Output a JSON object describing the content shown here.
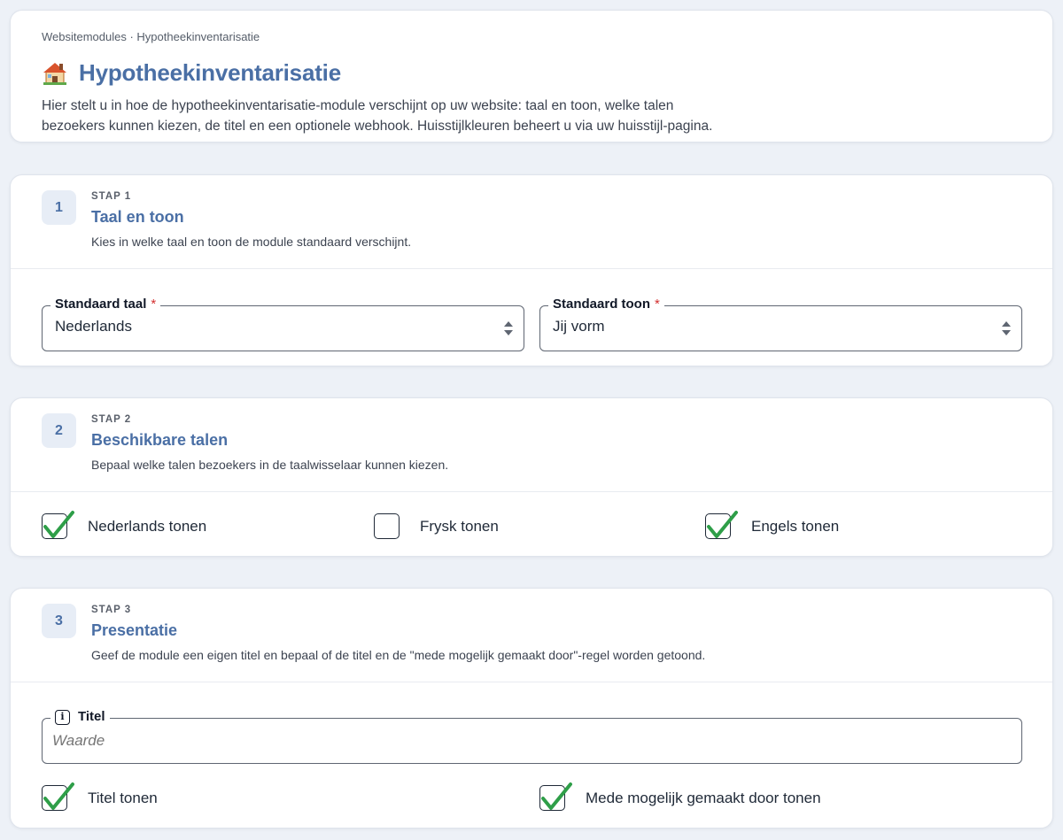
{
  "breadcrumb": "Websitemodules · Hypotheekinventarisatie",
  "page": {
    "title": "Hypotheekinventarisatie",
    "icon": "house-icon",
    "intro": "Hier stelt u in hoe de hypotheekinventarisatie-module verschijnt op uw website: taal en toon, welke talen bezoekers kunnen kiezen, de titel en een optionele webhook. Huisstijlkleuren beheert u via uw huisstijl-pagina."
  },
  "steps": [
    {
      "number": "1",
      "kicker": "STAP 1",
      "title": "Taal en toon",
      "description": "Kies in welke taal en toon de module standaard verschijnt.",
      "fields": [
        {
          "label": "Standaard taal",
          "required": "*",
          "value": "Nederlands"
        },
        {
          "label": "Standaard toon",
          "required": "*",
          "value": "Jij vorm"
        }
      ]
    },
    {
      "number": "2",
      "kicker": "STAP 2",
      "title": "Beschikbare talen",
      "description": "Bepaal welke talen bezoekers in de taalwisselaar kunnen kiezen.",
      "checkboxes": [
        {
          "label": "Nederlands tonen",
          "checked": true
        },
        {
          "label": "Frysk tonen",
          "checked": false
        },
        {
          "label": "Engels tonen",
          "checked": true
        }
      ]
    },
    {
      "number": "3",
      "kicker": "STAP 3",
      "title": "Presentatie",
      "description": "Geef de module een eigen titel en bepaal of de titel en de \"mede mogelijk gemaakt door\"-regel worden getoond.",
      "title_field": {
        "label": "Titel",
        "info_icon": "i",
        "placeholder": "Waarde",
        "value": ""
      },
      "checkboxes": [
        {
          "label": "Titel tonen",
          "checked": true
        },
        {
          "label": "Mede mogelijk gemaakt door tonen",
          "checked": true
        }
      ]
    }
  ],
  "colors": {
    "accent": "#4a6fa5",
    "check": "#2e9e48",
    "required": "#d32f2f",
    "background": "#edf1f7"
  }
}
